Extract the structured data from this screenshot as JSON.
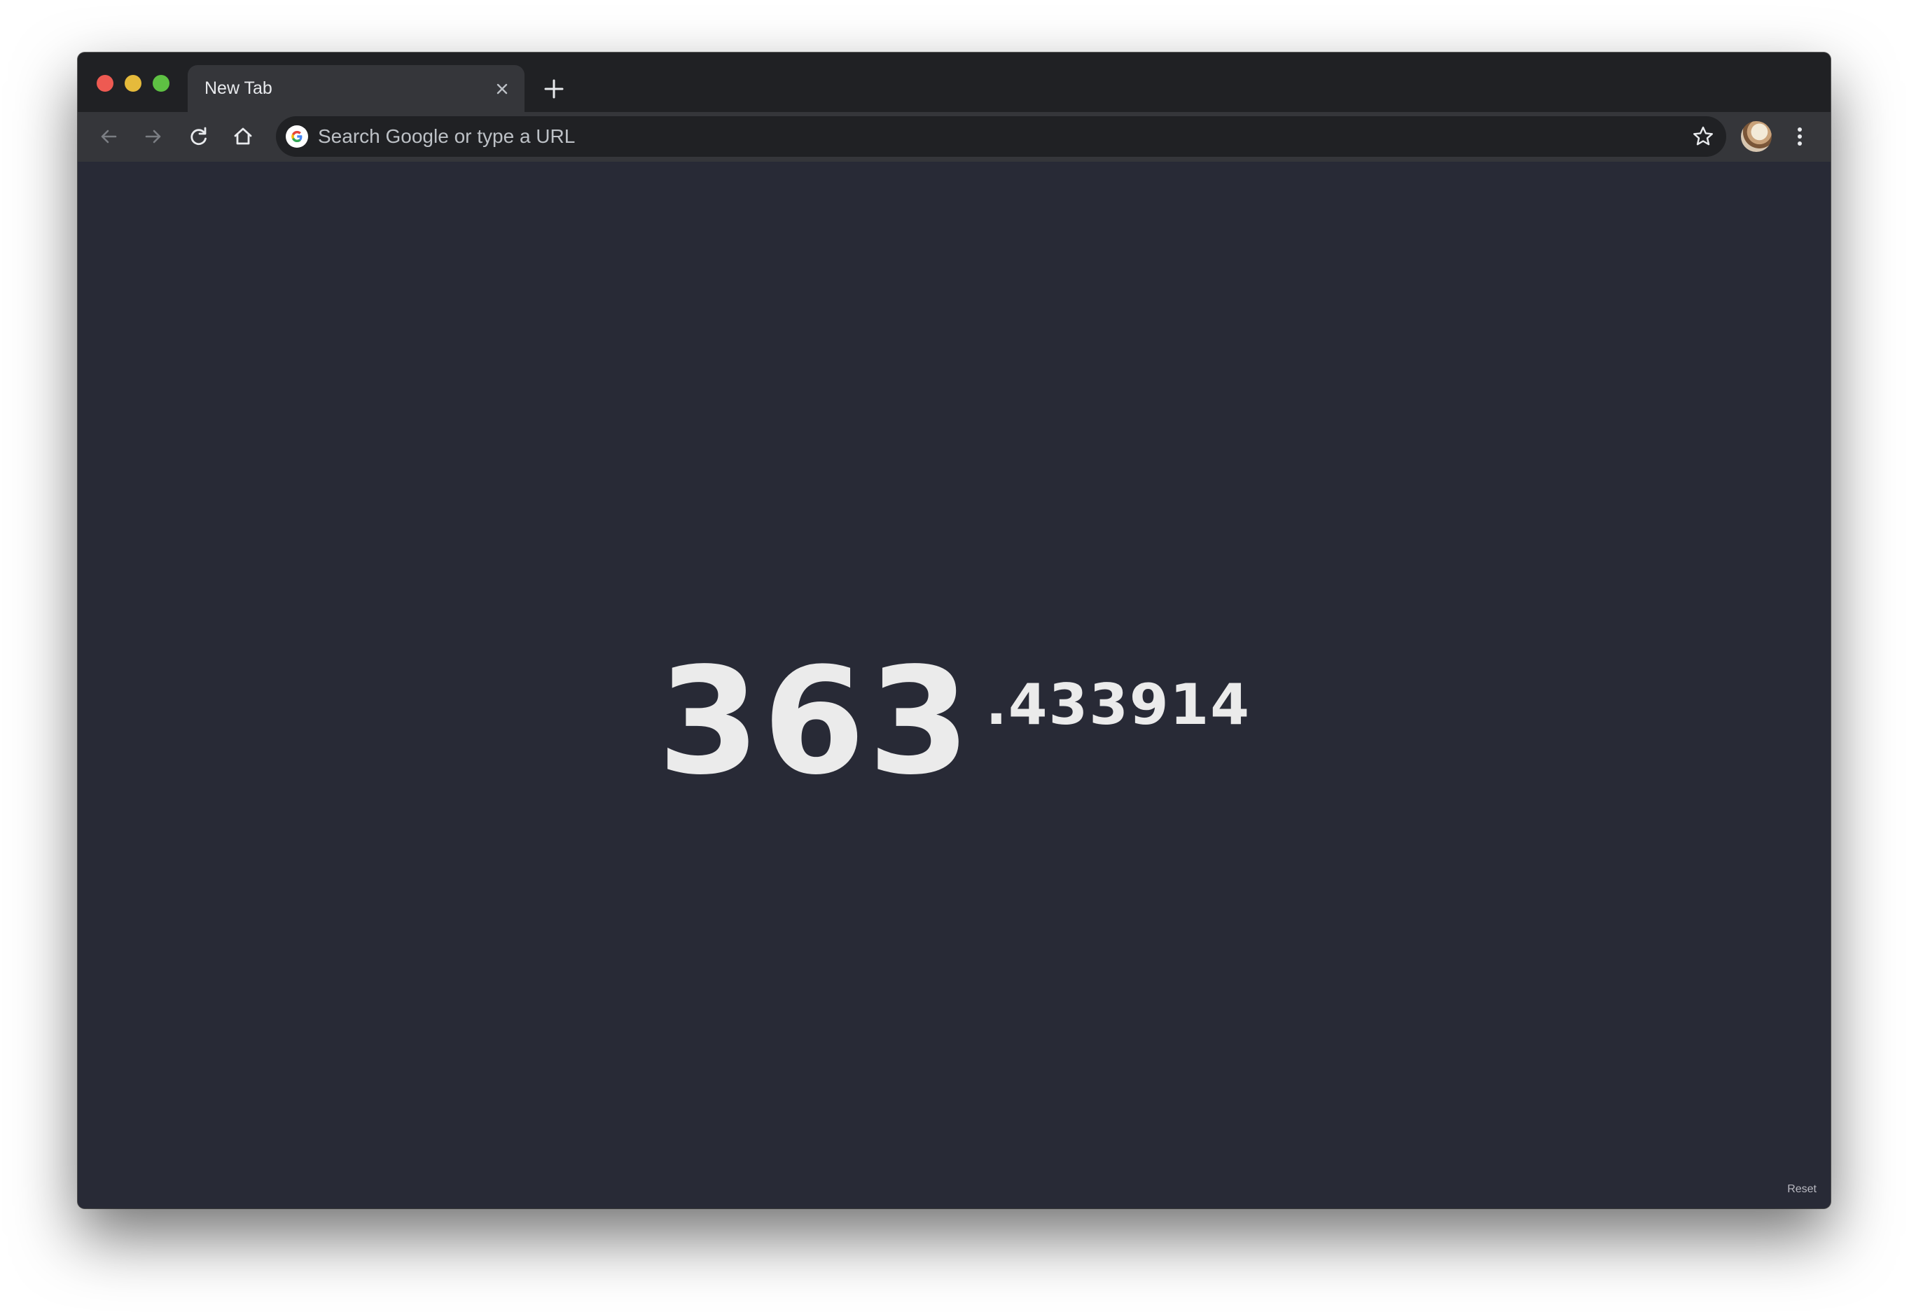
{
  "browser": {
    "tab": {
      "title": "New Tab"
    },
    "omnibox": {
      "placeholder": "Search Google or type a URL",
      "value": ""
    },
    "icons": {
      "back": "back-arrow-icon",
      "forward": "forward-arrow-icon",
      "reload": "reload-icon",
      "home": "home-icon",
      "bookmark": "star-icon",
      "menu": "more-vertical-icon",
      "new_tab": "plus-icon",
      "close_tab": "close-icon",
      "search_engine": "google-icon"
    },
    "colors": {
      "titlebar": "#202124",
      "toolbar": "#35363a",
      "omnibox": "#202124",
      "page_background": "#282a36",
      "traffic_red": "#ee5a52",
      "traffic_yellow": "#e5ba3b",
      "traffic_green": "#5ec143"
    }
  },
  "page": {
    "age_integer": "363",
    "age_fraction": ".433914",
    "reset_label": "Reset",
    "text_color": "#ebebeb"
  }
}
